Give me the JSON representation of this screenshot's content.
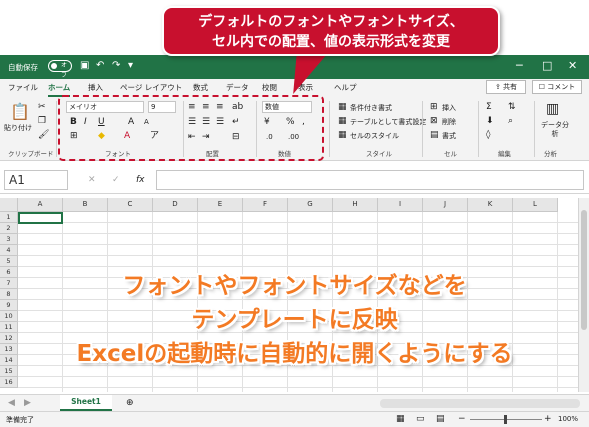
{
  "title_bar": {
    "autosave_label": "自動保存",
    "autosave_state": "オフ"
  },
  "tabs": [
    "ファイル",
    "ホーム",
    "挿入",
    "ページ レイアウト",
    "数式",
    "データ",
    "校閲",
    "表示",
    "ヘルプ"
  ],
  "active_tab": "ホーム",
  "share_label": "共有",
  "comment_label": "コメント",
  "ribbon": {
    "clipboard": {
      "paste": "貼り付け",
      "label": "クリップボード"
    },
    "font": {
      "name": "メイリオ",
      "size": "9",
      "label": "フォント"
    },
    "alignment": {
      "label": "配置"
    },
    "number": {
      "format": "数値",
      "label": "数値"
    },
    "styles": {
      "conditional": "条件付き書式",
      "table": "テーブルとして書式設定",
      "cell_styles": "セルのスタイル",
      "label": "スタイル"
    },
    "cells": {
      "insert": "挿入",
      "delete": "削除",
      "format": "書式",
      "label": "セル"
    },
    "editing": {
      "label": "編集"
    },
    "analysis": {
      "button": "データ分析",
      "label": "分析"
    }
  },
  "callout": {
    "line1": "デフォルトのフォントやフォントサイズ、",
    "line2": "セル内での配置、値の表示形式を変更"
  },
  "name_box": "A1",
  "columns": [
    "A",
    "B",
    "C",
    "D",
    "E",
    "F",
    "G",
    "H",
    "I",
    "J",
    "K",
    "L"
  ],
  "rows": [
    "1",
    "2",
    "3",
    "4",
    "5",
    "6",
    "7",
    "8",
    "9",
    "10",
    "11",
    "12",
    "13",
    "14",
    "15",
    "16"
  ],
  "overlay": {
    "line1": "フォントやフォントサイズなどを",
    "line2": "テンプレートに反映",
    "line3": "Excelの起動時に自動的に開くようにする"
  },
  "sheet_tab": "Sheet1",
  "status": "準備完了",
  "zoom": "100%",
  "colors": {
    "excel_green": "#217346",
    "callout_red": "#c8102e",
    "overlay_orange": "#f37a24"
  }
}
